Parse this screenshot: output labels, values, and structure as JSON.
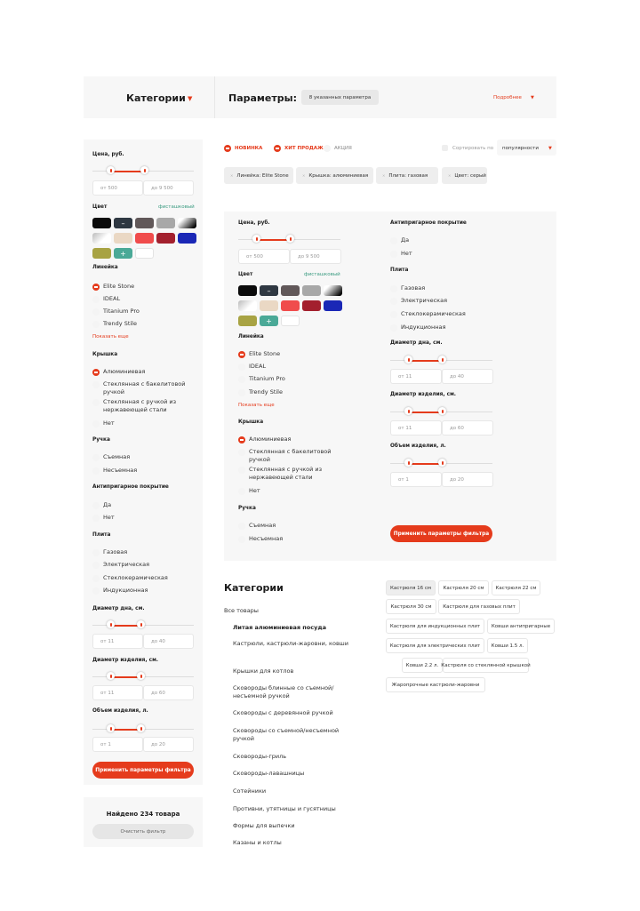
{
  "header": {
    "categories_title": "Категории",
    "params_title": "Параметры:",
    "params_count": "8 указанных параметра",
    "details_link": "Подробнее"
  },
  "filter": {
    "price": {
      "label": "Цена, руб.",
      "from": "от 500",
      "to": "до 9 500"
    },
    "color": {
      "label": "Цвет",
      "selected_name": "фисташковый"
    },
    "colors": [
      "#0b0b0b",
      "#2f3842",
      "#615859",
      "#a8a8a8",
      "gradient-white-black",
      "gradient-grey-white",
      "#ead8c4",
      "#f04c4c",
      "#a3202e",
      "#1a27b6",
      "#a8a343",
      "#4aa997",
      "#ffffff"
    ],
    "line": {
      "label": "Линейка",
      "options": [
        "Elite Stone",
        "IDEAL",
        "Titanium Pro",
        "Trendy Stile"
      ],
      "show_more": "Показать еще"
    },
    "lid": {
      "label": "Крышка",
      "options": [
        "Алюминиевая",
        "Стеклянная с бакелитовой ручкой",
        "Стеклянная с ручкой из нержавеющей стали",
        "Нет"
      ]
    },
    "handle": {
      "label": "Ручка",
      "options": [
        "Съемная",
        "Несъемная"
      ]
    },
    "coating": {
      "label": "Антипригарное покрытие",
      "options": [
        "Да",
        "Нет"
      ]
    },
    "stove": {
      "label": "Плита",
      "options": [
        "Газовая",
        "Электрическая",
        "Стеклокерамическая",
        "Индукционная"
      ]
    },
    "bottom": {
      "label": "Диаметр дна, см.",
      "from": "от 11",
      "to": "до 40"
    },
    "diameter": {
      "label": "Диаметр изделия, см.",
      "from": "от 11",
      "to": "до 60"
    },
    "volume": {
      "label": "Объем изделия, л.",
      "from": "от 1",
      "to": "до 20"
    },
    "apply_label": "Применить параметры фильтра",
    "found": "Найдено 234 товара",
    "clear": "Очистить фильтр"
  },
  "toolbar": {
    "badge_new": "НОВИНКА",
    "badge_hit": "ХИТ ПРОДАЖ",
    "badge_sale": "АКЦИЯ",
    "sort_label": "Сортировать по",
    "sort_value": "популярности"
  },
  "chips": [
    "Линейка: Elite Stone",
    "Крышка: алюминиевая",
    "Плита: газовая",
    "Цвет: серый"
  ],
  "panel": {
    "price_label": "Цена, руб.",
    "price_from": "от 500",
    "price_to": "до 9 500",
    "color_label": "Цвет",
    "color_selected": "фисташковый",
    "line_label": "Линейка",
    "lines": [
      "Elite Stone",
      "IDEAL",
      "Titanium Pro",
      "Trendy Stile"
    ],
    "show_more": "Показать еще",
    "lid_label": "Крышка",
    "lids": [
      "Алюминиевая",
      "Стеклянная с бакелитовой ручкой",
      "Стеклянная с ручкой из нержавеющей стали",
      "Нет"
    ],
    "handle_label": "Ручка",
    "handles": [
      "Съемная",
      "Несъемная"
    ],
    "coating_label": "Антипригарное покрытие",
    "coatings": [
      "Да",
      "Нет"
    ],
    "stove_label": "Плита",
    "stoves": [
      "Газовая",
      "Электрическая",
      "Стеклокерамическая",
      "Индукционная"
    ],
    "bottom_label": "Диаметр дна, см.",
    "bottom_from": "от 11",
    "bottom_to": "до 40",
    "diam_label": "Диаметр изделия, см.",
    "diam_from": "от 11",
    "diam_to": "до 60",
    "vol_label": "Объем изделия, л.",
    "vol_from": "от 1",
    "vol_to": "до 20",
    "apply": "Применить параметры фильтра"
  },
  "categories": {
    "title": "Категории",
    "all": "Все товары",
    "items": [
      "Литая алюминиевая посуда",
      "Кастрюли, кастрюли-жаровни, ковши",
      "Крышки для котлов",
      "Сковороды блинные со съемной/несъемной ручкой",
      "Сковороды с деревянной ручкой",
      "Сковороды со съемной/несъемной ручкой",
      "Сковороды-гриль",
      "Сковороды-лаваш­ницы",
      "Сотейники",
      "Противни, утятницы и гусятницы",
      "Формы для выпечки",
      "Казаны и котлы"
    ]
  },
  "tags": [
    "Кастрюля 16 см",
    "Кастрюля 20 см",
    "Кастрюля 22 см",
    "Кастрюля 30 см",
    "Кастрюля для газовых плит",
    "Кастрюля для индукционных плит",
    "Ковши антипригарные",
    "Кастрюля для электрических плит",
    "Ковши 1.5 л.",
    "Ковши 2.2 л.",
    "Кастрюля со стеклянной крышкой",
    "Жаропрочные кастрюли-жаровни"
  ]
}
